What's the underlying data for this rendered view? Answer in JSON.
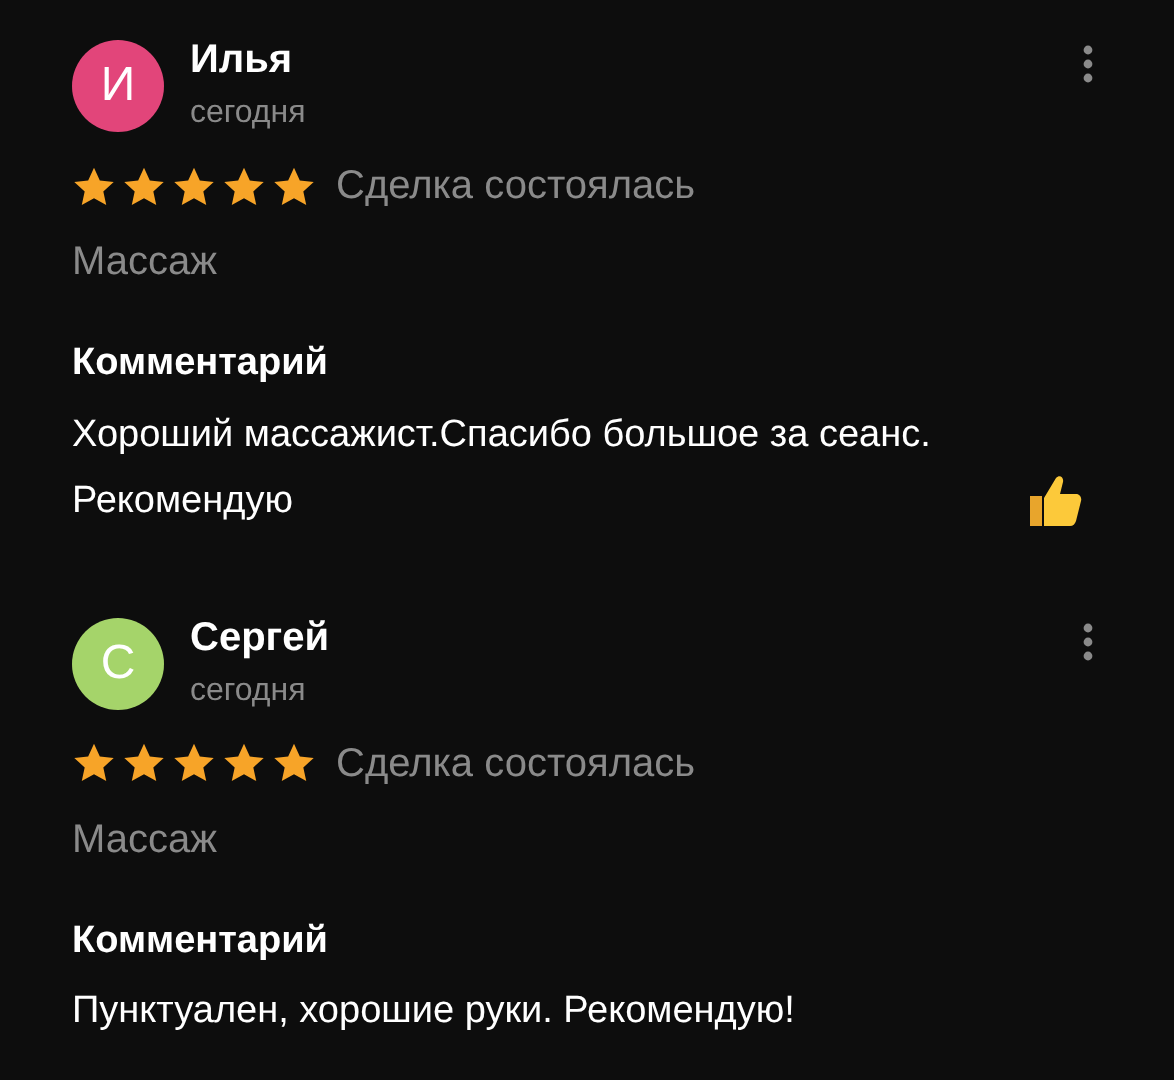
{
  "reviews": [
    {
      "initial": "И",
      "color": "#e2457a",
      "name": "Илья",
      "date": "сегодня",
      "stars": 5,
      "deal": "Сделка состоялась",
      "service": "Массаж",
      "comment_label": "Комментарий",
      "comment": "Хороший массажист.Спасибо большое за сеанс. Рекомендую",
      "thumbs_up": true
    },
    {
      "initial": "С",
      "color": "#a5d46a",
      "name": "Сергей",
      "date": "сегодня",
      "stars": 5,
      "deal": "Сделка состоялась",
      "service": "Массаж",
      "comment_label": "Комментарий",
      "comment": "Пунктуален, хорошие руки. Рекомендую!",
      "thumbs_up": false
    }
  ]
}
